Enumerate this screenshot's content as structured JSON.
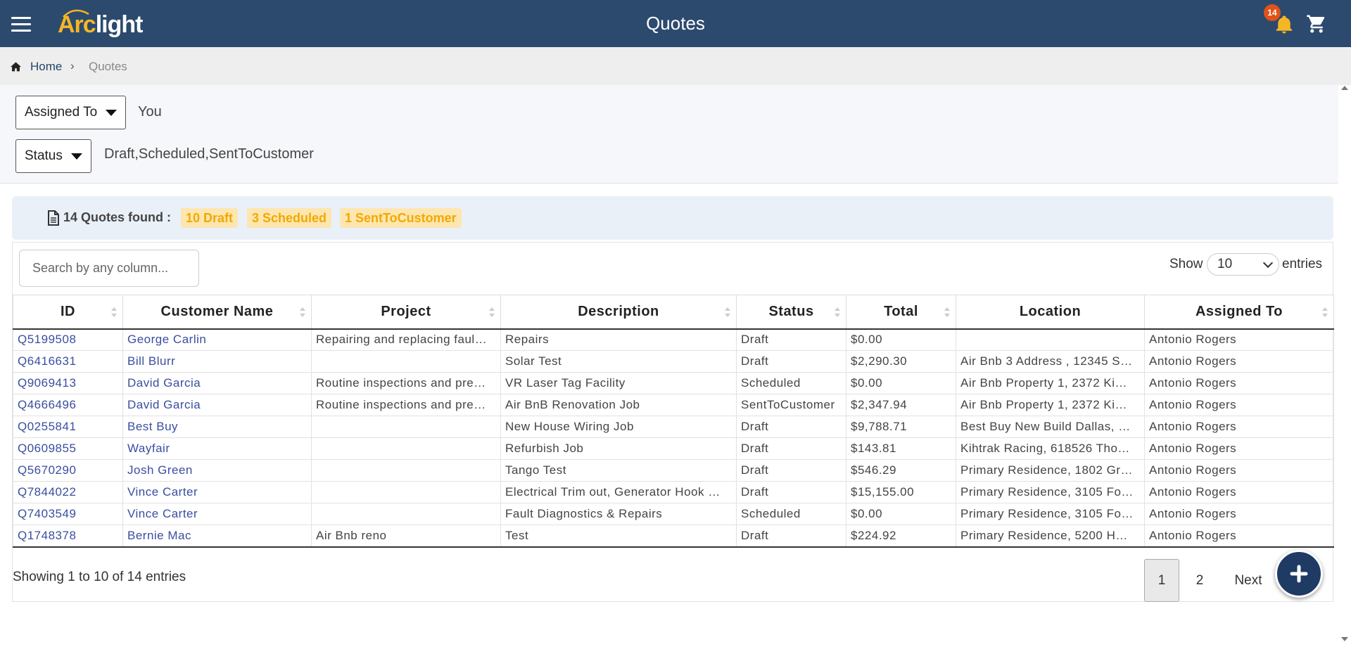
{
  "header": {
    "logo_arc": "Arc",
    "logo_light": "light",
    "title": "Quotes",
    "notification_count": "14",
    "icons": [
      "menu-icon",
      "bell-icon",
      "cart-icon"
    ]
  },
  "breadcrumb": {
    "home": "Home",
    "separator": "›",
    "current": "Quotes"
  },
  "filters": {
    "assigned_to": {
      "label": "Assigned To",
      "value": "You"
    },
    "status": {
      "label": "Status",
      "value": "Draft,Scheduled,SentToCustomer"
    }
  },
  "summary": {
    "text": "14 Quotes found :",
    "chips": [
      "10 Draft",
      "3 Scheduled",
      "1 SentToCustomer"
    ]
  },
  "table_controls": {
    "search_placeholder": "Search by any column...",
    "show_label": "Show",
    "entries_value": "10",
    "entries_label": "entries"
  },
  "table": {
    "columns": [
      "ID",
      "Customer Name",
      "Project",
      "Description",
      "Status",
      "Total",
      "Location",
      "Assigned To"
    ],
    "rows": [
      [
        "Q5199508",
        "George Carlin",
        "Repairing and replacing faul…",
        "Repairs",
        "Draft",
        "$0.00",
        "",
        "Antonio Rogers"
      ],
      [
        "Q6416631",
        "Bill Blurr",
        "",
        "Solar Test",
        "Draft",
        "$2,290.30",
        "Air Bnb 3 Address , 12345 S…",
        "Antonio Rogers"
      ],
      [
        "Q9069413",
        "David Garcia",
        "Routine inspections and pre…",
        "VR Laser Tag Facility",
        "Scheduled",
        "$0.00",
        "Air Bnb Property 1, 2372 Ki…",
        "Antonio Rogers"
      ],
      [
        "Q4666496",
        "David Garcia",
        "Routine inspections and pre…",
        "Air BnB Renovation Job",
        "SentToCustomer",
        "$2,347.94",
        "Air Bnb Property 1, 2372 Ki…",
        "Antonio Rogers"
      ],
      [
        "Q0255841",
        "Best Buy",
        "",
        "New House Wiring Job",
        "Draft",
        "$9,788.71",
        "Best Buy New Build Dallas, …",
        "Antonio Rogers"
      ],
      [
        "Q0609855",
        "Wayfair",
        "",
        "Refurbish Job",
        "Draft",
        "$143.81",
        "Kihtrak Racing, 618526 Tho…",
        "Antonio Rogers"
      ],
      [
        "Q5670290",
        "Josh Green",
        "",
        "Tango Test",
        "Draft",
        "$546.29",
        "Primary Residence, 1802 Gr…",
        "Antonio Rogers"
      ],
      [
        "Q7844022",
        "Vince Carter",
        "",
        "Electrical Trim out, Generator Hook …",
        "Draft",
        "$15,155.00",
        "Primary Residence, 3105 Fo…",
        "Antonio Rogers"
      ],
      [
        "Q7403549",
        "Vince Carter",
        "",
        "Fault Diagnostics & Repairs",
        "Scheduled",
        "$0.00",
        "Primary Residence, 3105 Fo…",
        "Antonio Rogers"
      ],
      [
        "Q1748378",
        "Bernie Mac",
        "Air Bnb reno",
        "Test",
        "Draft",
        "$224.92",
        "Primary Residence, 5200 H…",
        "Antonio Rogers"
      ]
    ]
  },
  "footer": {
    "showing": "Showing 1 to 10 of 14 entries",
    "pages": [
      "1",
      "2"
    ],
    "next": "Next"
  },
  "colors": {
    "header_bg": "#2c4a6e",
    "accent": "#f5b624",
    "chip_text": "#f2a900",
    "link": "#3a4ea0",
    "fab": "#1f3a63"
  }
}
